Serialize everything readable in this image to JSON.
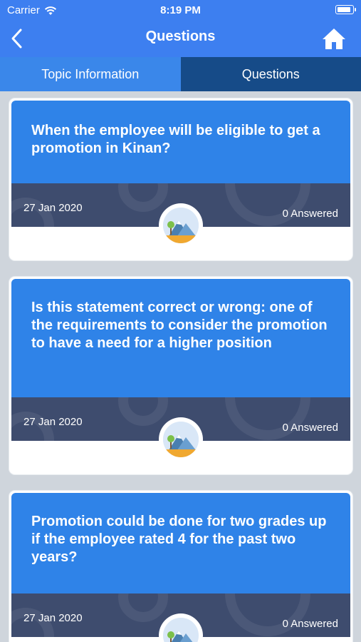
{
  "status_bar": {
    "carrier": "Carrier",
    "time": "8:19 PM"
  },
  "nav": {
    "title": "Questions",
    "back_icon": "chevron-left-icon",
    "home_icon": "home-icon"
  },
  "tabs": [
    {
      "label": "Topic Information",
      "selected": false
    },
    {
      "label": "Questions",
      "selected": true
    }
  ],
  "questions": [
    {
      "text": "When the employee will be eligible to get a promotion in Kinan?",
      "date": "27 Jan 2020",
      "answered": "0 Answered"
    },
    {
      "text": "Is this statement correct or wrong: one of the requirements to consider the promotion to have a need for a higher position",
      "date": "27 Jan 2020",
      "answered": "0 Answered"
    },
    {
      "text": "Promotion could be done for two grades up if the employee rated 4 for the past two years?",
      "date": "27 Jan 2020",
      "answered": "0 Answered"
    }
  ],
  "colors": {
    "header": "#3d7ff0",
    "tab_inactive": "#3a87ea",
    "tab_active": "#164b88",
    "card_top": "#2f83e8",
    "card_band": "#3e4c6e"
  }
}
